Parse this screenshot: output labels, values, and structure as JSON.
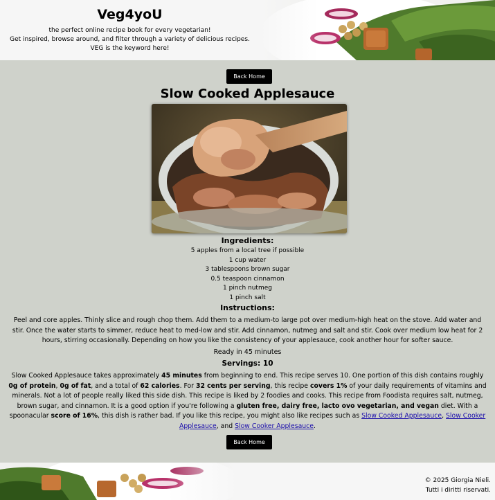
{
  "header": {
    "brand": "Veg4yoU",
    "tagline_lines": [
      "the perfect online recipe book for every vegetarian!",
      "Get inspired, browse around, and filter through a variety of delicious recipes.",
      "VEG is the keyword here!"
    ]
  },
  "nav": {
    "back_label": "Back Home"
  },
  "recipe": {
    "title": "Slow Cooked Applesauce",
    "ingredients_heading": "Ingredients:",
    "ingredients": [
      "5 apples from a local tree if possible",
      "1 cup water",
      "3 tablespoons brown sugar",
      "0.5 teaspoon cinnamon",
      "1 pinch nutmeg",
      "1 pinch salt"
    ],
    "instructions_heading": "Instructions:",
    "instructions": "Peel and core apples. Thinly slice and rough chop them. Add them to a medium-to large pot over medium-high heat on the stove. Add water and stir. Once the water starts to simmer, reduce heat to med-low and stir. Add cinnamon, nutmeg and salt and stir. Cook over medium low heat for 2 hours, stirring occasionally. Depending on how you like the consistency of your applesauce, cook another hour for softer sauce.",
    "ready_text": "Ready in 45 minutes",
    "servings_text": "Servings: 10",
    "summary": {
      "t1": "Slow Cooked Applesauce takes approximately ",
      "b1": "45 minutes",
      "t2": " from beginning to end. This recipe serves 10. One portion of this dish contains roughly ",
      "b2": "0g of protein",
      "t3": ", ",
      "b3": "0g of fat",
      "t4": ", and a total of ",
      "b4": "62 calories",
      "t5": ". For ",
      "b5": "32 cents per serving",
      "t6": ", this recipe ",
      "b6": "covers 1%",
      "t7": " of your daily requirements of vitamins and minerals. Not a lot of people really liked this side dish. This recipe is liked by 2 foodies and cooks. This recipe from Foodista requires salt, nutmeg, brown sugar, and cinnamon. It is a good option if you're following a ",
      "b7": "gluten free, dairy free, lacto ovo vegetarian, and vegan",
      "t8": " diet. With a spoonacular ",
      "b8": "score of 16%",
      "t9": ", this dish is rather bad. If you like this recipe, you might also like recipes such as ",
      "link1": "Slow Cooked Applesauce",
      "t10": ", ",
      "link2": "Slow Cooker Applesauce",
      "t11": ", and ",
      "link3": "Slow Cooker Applesauce",
      "t12": "."
    }
  },
  "footer": {
    "copyright": "© 2025 Giorgia Nieli.",
    "rights": "Tutti i diritti riservati."
  },
  "images": {
    "header_art": "salad-photo",
    "recipe_photo": "applesauce-bowl-photo"
  }
}
